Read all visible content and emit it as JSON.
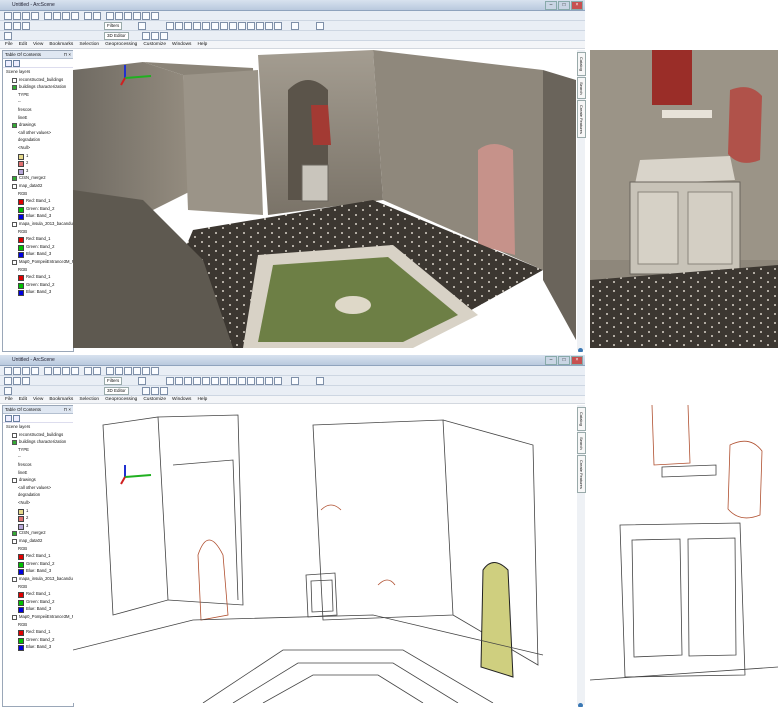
{
  "screenshots": [
    {
      "id": "textured",
      "window_title": "Untitled - ArcScene",
      "toolbar": {
        "filters_label": "Filters",
        "editor_label": "3D Editor"
      },
      "menu": [
        "File",
        "Edit",
        "View",
        "Bookmarks",
        "Selection",
        "Geoprocessing",
        "Customize",
        "Windows",
        "Help"
      ],
      "toc": {
        "title": "Table Of Contents",
        "items": [
          {
            "label": "Scene layers",
            "level": 0,
            "checkbox": false
          },
          {
            "label": "reconstructed_buildings",
            "level": 1,
            "checkbox": true,
            "checked": false
          },
          {
            "label": "buildings characterization",
            "level": 1,
            "checkbox": true,
            "checked": true
          },
          {
            "label": "TYPE",
            "level": 2
          },
          {
            "label": "--",
            "level": 2
          },
          {
            "label": "frescos",
            "level": 2
          },
          {
            "label": "lineE",
            "level": 2
          },
          {
            "label": "drawings",
            "level": 1,
            "checkbox": true,
            "checked": true
          },
          {
            "label": "<all other values>",
            "level": 2
          },
          {
            "label": "degradation",
            "level": 2
          },
          {
            "label": "<Null>",
            "level": 2
          },
          {
            "label": "1",
            "level": 2,
            "swatch": "#e6d98a"
          },
          {
            "label": "2",
            "level": 2,
            "swatch": "#e07070"
          },
          {
            "label": "3",
            "level": 2,
            "swatch": "#b7a6d8"
          },
          {
            "label": "CISN_merge2",
            "level": 1,
            "checkbox": true,
            "checked": true
          },
          {
            "label": "map_data02",
            "level": 1,
            "checkbox": true,
            "checked": false
          },
          {
            "label": "RGB",
            "level": 2
          },
          {
            "label": "Red: Band_1",
            "level": 2,
            "swatch": "#e00000"
          },
          {
            "label": "Green: Band_2",
            "level": 2,
            "swatch": "#00c000"
          },
          {
            "label": "Blue: Band_3",
            "level": 2,
            "swatch": "#0000e0"
          },
          {
            "label": "mapa_insula_2013_bacandus_3",
            "level": 1,
            "checkbox": true,
            "checked": false
          },
          {
            "label": "RGB",
            "level": 2
          },
          {
            "label": "Red: Band_1",
            "level": 2,
            "swatch": "#e00000"
          },
          {
            "label": "Green: Band_2",
            "level": 2,
            "swatch": "#00c000"
          },
          {
            "label": "Blue: Band_3",
            "level": 2,
            "swatch": "#0000e0"
          },
          {
            "label": "Map0_PompeiiEntrance3M_P",
            "level": 1,
            "checkbox": true,
            "checked": false
          },
          {
            "label": "RGB",
            "level": 2
          },
          {
            "label": "Red: Band_1",
            "level": 2,
            "swatch": "#e00000"
          },
          {
            "label": "Green: Band_2",
            "level": 2,
            "swatch": "#00c000"
          },
          {
            "label": "Blue: Band_3",
            "level": 2,
            "swatch": "#0000e0"
          }
        ]
      },
      "side_tabs": [
        "Catalog",
        "Search",
        "Create Features"
      ]
    },
    {
      "id": "vector",
      "window_title": "Untitled - ArcScene",
      "toolbar": {
        "filters_label": "Filters",
        "editor_label": "3D Editor"
      },
      "menu": [
        "File",
        "Edit",
        "View",
        "Bookmarks",
        "Selection",
        "Geoprocessing",
        "Customize",
        "Windows",
        "Help"
      ],
      "toc": {
        "title": "Table Of Contents",
        "items": [
          {
            "label": "Scene layers",
            "level": 0,
            "checkbox": false
          },
          {
            "label": "reconstructed_buildings",
            "level": 1,
            "checkbox": true,
            "checked": false
          },
          {
            "label": "buildings characterization",
            "level": 1,
            "checkbox": true,
            "checked": true
          },
          {
            "label": "TYPE",
            "level": 2
          },
          {
            "label": "--",
            "level": 2
          },
          {
            "label": "frescos",
            "level": 2
          },
          {
            "label": "lineE",
            "level": 2
          },
          {
            "label": "drawings",
            "level": 1,
            "checkbox": true,
            "checked": false
          },
          {
            "label": "<all other values>",
            "level": 2
          },
          {
            "label": "degradation",
            "level": 2
          },
          {
            "label": "<Null>",
            "level": 2
          },
          {
            "label": "1",
            "level": 2,
            "swatch": "#e6d98a"
          },
          {
            "label": "2",
            "level": 2,
            "swatch": "#e07070"
          },
          {
            "label": "3",
            "level": 2,
            "swatch": "#b7a6d8"
          },
          {
            "label": "CISN_merge2",
            "level": 1,
            "checkbox": true,
            "checked": true
          },
          {
            "label": "map_data02",
            "level": 1,
            "checkbox": true,
            "checked": false
          },
          {
            "label": "RGB",
            "level": 2
          },
          {
            "label": "Red: Band_1",
            "level": 2,
            "swatch": "#e00000"
          },
          {
            "label": "Green: Band_2",
            "level": 2,
            "swatch": "#00c000"
          },
          {
            "label": "Blue: Band_3",
            "level": 2,
            "swatch": "#0000e0"
          },
          {
            "label": "mapa_insula_2013_bacandus_3",
            "level": 1,
            "checkbox": true,
            "checked": false
          },
          {
            "label": "RGB",
            "level": 2
          },
          {
            "label": "Red: Band_1",
            "level": 2,
            "swatch": "#e00000"
          },
          {
            "label": "Green: Band_2",
            "level": 2,
            "swatch": "#00c000"
          },
          {
            "label": "Blue: Band_3",
            "level": 2,
            "swatch": "#0000e0"
          },
          {
            "label": "Map0_PompeiiEntrance3M_P",
            "level": 1,
            "checkbox": true,
            "checked": false
          },
          {
            "label": "RGB",
            "level": 2
          },
          {
            "label": "Red: Band_1",
            "level": 2,
            "swatch": "#e00000"
          },
          {
            "label": "Green: Band_2",
            "level": 2,
            "swatch": "#00c000"
          },
          {
            "label": "Blue: Band_3",
            "level": 2,
            "swatch": "#0000e0"
          }
        ]
      },
      "side_tabs": [
        "Catalog",
        "Search",
        "Create Features"
      ]
    }
  ],
  "colors": {
    "fresco_red": "#b8473e",
    "stone": "#8c8579",
    "floor": "#3f3a33",
    "pool_green": "#6d7f45",
    "highlight_fill": "#cfcf7f",
    "outline": "#444444",
    "degradation_line": "#b05030"
  }
}
